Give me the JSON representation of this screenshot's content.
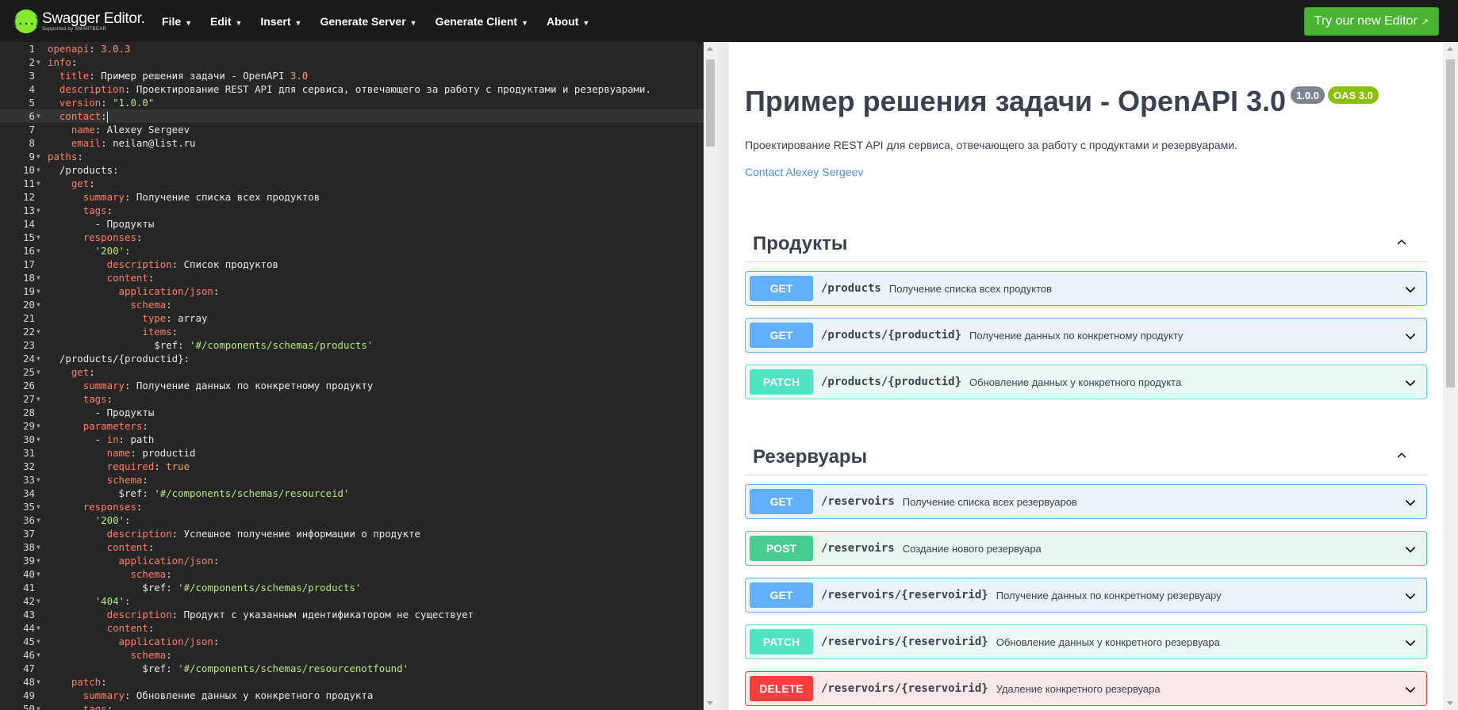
{
  "topbar": {
    "logo_title": "Swagger Editor.",
    "logo_sub": "Supported by SMARTBEAR",
    "logo_glyph": "{...}",
    "menu": [
      {
        "label": "File"
      },
      {
        "label": "Edit"
      },
      {
        "label": "Insert"
      },
      {
        "label": "Generate Server"
      },
      {
        "label": "Generate Client"
      },
      {
        "label": "About"
      }
    ],
    "caret": "▼",
    "try_button": "Try our new Editor",
    "try_button_icon": "↗"
  },
  "editor": {
    "lines": [
      {
        "n": "1",
        "f": false,
        "t": [
          [
            "k",
            "openapi"
          ],
          [
            "p",
            ": "
          ],
          [
            "n",
            "3.0.3"
          ]
        ]
      },
      {
        "n": "2",
        "f": true,
        "t": [
          [
            "k",
            "info"
          ],
          [
            "p",
            ":"
          ]
        ]
      },
      {
        "n": "3",
        "f": false,
        "t": [
          [
            "p",
            "  "
          ],
          [
            "k",
            "title"
          ],
          [
            "p",
            ": Пример решения задачи - OpenAPI "
          ],
          [
            "n",
            "3.0"
          ]
        ]
      },
      {
        "n": "4",
        "f": false,
        "t": [
          [
            "p",
            "  "
          ],
          [
            "k",
            "description"
          ],
          [
            "p",
            ": Проектирование REST API для сервиса, отвечающего за работу с продуктами и резервуарами."
          ]
        ]
      },
      {
        "n": "5",
        "f": false,
        "t": [
          [
            "p",
            "  "
          ],
          [
            "k",
            "version"
          ],
          [
            "p",
            ": "
          ],
          [
            "s",
            "\"1.0.0\""
          ]
        ]
      },
      {
        "n": "6",
        "f": true,
        "a": true,
        "t": [
          [
            "p",
            "  "
          ],
          [
            "k",
            "contact"
          ],
          [
            "p",
            ":"
          ]
        ]
      },
      {
        "n": "7",
        "f": false,
        "t": [
          [
            "p",
            "    "
          ],
          [
            "k",
            "name"
          ],
          [
            "p",
            ": Alexey Sergeev"
          ]
        ]
      },
      {
        "n": "8",
        "f": false,
        "t": [
          [
            "p",
            "    "
          ],
          [
            "k",
            "email"
          ],
          [
            "p",
            ": neilan@list.ru"
          ]
        ]
      },
      {
        "n": "9",
        "f": true,
        "t": [
          [
            "k",
            "paths"
          ],
          [
            "p",
            ":"
          ]
        ]
      },
      {
        "n": "10",
        "f": true,
        "t": [
          [
            "p",
            "  /products:"
          ]
        ]
      },
      {
        "n": "11",
        "f": true,
        "t": [
          [
            "p",
            "    "
          ],
          [
            "k",
            "get"
          ],
          [
            "p",
            ":"
          ]
        ]
      },
      {
        "n": "12",
        "f": false,
        "t": [
          [
            "p",
            "      "
          ],
          [
            "k",
            "summary"
          ],
          [
            "p",
            ": Получение списка всех продуктов"
          ]
        ]
      },
      {
        "n": "13",
        "f": true,
        "t": [
          [
            "p",
            "      "
          ],
          [
            "k",
            "tags"
          ],
          [
            "p",
            ":"
          ]
        ]
      },
      {
        "n": "14",
        "f": false,
        "t": [
          [
            "p",
            "        - Продукты"
          ]
        ]
      },
      {
        "n": "15",
        "f": true,
        "t": [
          [
            "p",
            "      "
          ],
          [
            "k",
            "responses"
          ],
          [
            "p",
            ":"
          ]
        ]
      },
      {
        "n": "16",
        "f": true,
        "t": [
          [
            "p",
            "        "
          ],
          [
            "s",
            "'200'"
          ],
          [
            "p",
            ":"
          ]
        ]
      },
      {
        "n": "17",
        "f": false,
        "t": [
          [
            "p",
            "          "
          ],
          [
            "k",
            "description"
          ],
          [
            "p",
            ": Список продуктов"
          ]
        ]
      },
      {
        "n": "18",
        "f": true,
        "t": [
          [
            "p",
            "          "
          ],
          [
            "k",
            "content"
          ],
          [
            "p",
            ":"
          ]
        ]
      },
      {
        "n": "19",
        "f": true,
        "t": [
          [
            "p",
            "            "
          ],
          [
            "k",
            "application/json"
          ],
          [
            "p",
            ":"
          ]
        ]
      },
      {
        "n": "20",
        "f": true,
        "t": [
          [
            "p",
            "              "
          ],
          [
            "k",
            "schema"
          ],
          [
            "p",
            ":"
          ]
        ]
      },
      {
        "n": "21",
        "f": false,
        "t": [
          [
            "p",
            "                "
          ],
          [
            "k",
            "type"
          ],
          [
            "p",
            ": array"
          ]
        ]
      },
      {
        "n": "22",
        "f": true,
        "t": [
          [
            "p",
            "                "
          ],
          [
            "k",
            "items"
          ],
          [
            "p",
            ":"
          ]
        ]
      },
      {
        "n": "23",
        "f": false,
        "t": [
          [
            "p",
            "                  $ref: "
          ],
          [
            "s",
            "'#/components/schemas/products'"
          ]
        ]
      },
      {
        "n": "24",
        "f": true,
        "t": [
          [
            "p",
            "  /products/{productid}:"
          ]
        ]
      },
      {
        "n": "25",
        "f": true,
        "t": [
          [
            "p",
            "    "
          ],
          [
            "k",
            "get"
          ],
          [
            "p",
            ":"
          ]
        ]
      },
      {
        "n": "26",
        "f": false,
        "t": [
          [
            "p",
            "      "
          ],
          [
            "k",
            "summary"
          ],
          [
            "p",
            ": Получение данных по конкретному продукту"
          ]
        ]
      },
      {
        "n": "27",
        "f": true,
        "t": [
          [
            "p",
            "      "
          ],
          [
            "k",
            "tags"
          ],
          [
            "p",
            ":"
          ]
        ]
      },
      {
        "n": "28",
        "f": false,
        "t": [
          [
            "p",
            "        - Продукты"
          ]
        ]
      },
      {
        "n": "29",
        "f": true,
        "t": [
          [
            "p",
            "      "
          ],
          [
            "k",
            "parameters"
          ],
          [
            "p",
            ":"
          ]
        ]
      },
      {
        "n": "30",
        "f": true,
        "t": [
          [
            "p",
            "        - "
          ],
          [
            "k",
            "in"
          ],
          [
            "p",
            ": path"
          ]
        ]
      },
      {
        "n": "31",
        "f": false,
        "t": [
          [
            "p",
            "          "
          ],
          [
            "k",
            "name"
          ],
          [
            "p",
            ": productid"
          ]
        ]
      },
      {
        "n": "32",
        "f": false,
        "t": [
          [
            "p",
            "          "
          ],
          [
            "k",
            "required"
          ],
          [
            "p",
            ": "
          ],
          [
            "n",
            "true"
          ]
        ]
      },
      {
        "n": "33",
        "f": true,
        "t": [
          [
            "p",
            "          "
          ],
          [
            "k",
            "schema"
          ],
          [
            "p",
            ":"
          ]
        ]
      },
      {
        "n": "34",
        "f": false,
        "t": [
          [
            "p",
            "            $ref: "
          ],
          [
            "s",
            "'#/components/schemas/resourceid'"
          ]
        ]
      },
      {
        "n": "35",
        "f": true,
        "t": [
          [
            "p",
            "      "
          ],
          [
            "k",
            "responses"
          ],
          [
            "p",
            ":"
          ]
        ]
      },
      {
        "n": "36",
        "f": true,
        "t": [
          [
            "p",
            "        "
          ],
          [
            "s",
            "'200'"
          ],
          [
            "p",
            ":"
          ]
        ]
      },
      {
        "n": "37",
        "f": false,
        "t": [
          [
            "p",
            "          "
          ],
          [
            "k",
            "description"
          ],
          [
            "p",
            ": Успешное получение информации о продукте"
          ]
        ]
      },
      {
        "n": "38",
        "f": true,
        "t": [
          [
            "p",
            "          "
          ],
          [
            "k",
            "content"
          ],
          [
            "p",
            ":"
          ]
        ]
      },
      {
        "n": "39",
        "f": true,
        "t": [
          [
            "p",
            "            "
          ],
          [
            "k",
            "application/json"
          ],
          [
            "p",
            ":"
          ]
        ]
      },
      {
        "n": "40",
        "f": true,
        "t": [
          [
            "p",
            "              "
          ],
          [
            "k",
            "schema"
          ],
          [
            "p",
            ":"
          ]
        ]
      },
      {
        "n": "41",
        "f": false,
        "t": [
          [
            "p",
            "                $ref: "
          ],
          [
            "s",
            "'#/components/schemas/products'"
          ]
        ]
      },
      {
        "n": "42",
        "f": true,
        "t": [
          [
            "p",
            "        "
          ],
          [
            "s",
            "'404'"
          ],
          [
            "p",
            ":"
          ]
        ]
      },
      {
        "n": "43",
        "f": false,
        "t": [
          [
            "p",
            "          "
          ],
          [
            "k",
            "description"
          ],
          [
            "p",
            ": Продукт с указанным идентификатором не существует"
          ]
        ]
      },
      {
        "n": "44",
        "f": true,
        "t": [
          [
            "p",
            "          "
          ],
          [
            "k",
            "content"
          ],
          [
            "p",
            ":"
          ]
        ]
      },
      {
        "n": "45",
        "f": true,
        "t": [
          [
            "p",
            "            "
          ],
          [
            "k",
            "application/json"
          ],
          [
            "p",
            ":"
          ]
        ]
      },
      {
        "n": "46",
        "f": true,
        "t": [
          [
            "p",
            "              "
          ],
          [
            "k",
            "schema"
          ],
          [
            "p",
            ":"
          ]
        ]
      },
      {
        "n": "47",
        "f": false,
        "t": [
          [
            "p",
            "                $ref: "
          ],
          [
            "s",
            "'#/components/schemas/resourcenotfound'"
          ]
        ]
      },
      {
        "n": "48",
        "f": true,
        "t": [
          [
            "p",
            "    "
          ],
          [
            "k",
            "patch"
          ],
          [
            "p",
            ":"
          ]
        ]
      },
      {
        "n": "49",
        "f": false,
        "t": [
          [
            "p",
            "      "
          ],
          [
            "k",
            "summary"
          ],
          [
            "p",
            ": Обновление данных у конкретного продукта"
          ]
        ]
      },
      {
        "n": "50",
        "f": true,
        "t": [
          [
            "p",
            "      "
          ],
          [
            "k",
            "tags"
          ],
          [
            "p",
            ":"
          ]
        ]
      }
    ]
  },
  "preview": {
    "title": "Пример решения задачи - OpenAPI 3.0",
    "version_badge": "1.0.0",
    "oas_badge": "OAS 3.0",
    "description": "Проектирование REST API для сервиса, отвечающего за работу с продуктами и резервуарами.",
    "contact": "Contact Alexey Sergeev",
    "tags": [
      {
        "name": "Продукты",
        "operations": [
          {
            "method": "GET",
            "path": "/products",
            "summary": "Получение списка всех продуктов"
          },
          {
            "method": "GET",
            "path": "/products/{productid}",
            "summary": "Получение данных по конкретному продукту"
          },
          {
            "method": "PATCH",
            "path": "/products/{productid}",
            "summary": "Обновление данных у конкретного продукта"
          }
        ]
      },
      {
        "name": "Резервуары",
        "operations": [
          {
            "method": "GET",
            "path": "/reservoirs",
            "summary": "Получение списка всех резервуаров"
          },
          {
            "method": "POST",
            "path": "/reservoirs",
            "summary": "Создание нового резервуара"
          },
          {
            "method": "GET",
            "path": "/reservoirs/{reservoirid}",
            "summary": "Получение данных по конкретному резервуару"
          },
          {
            "method": "PATCH",
            "path": "/reservoirs/{reservoirid}",
            "summary": "Обновление данных у конкретного резервуара"
          },
          {
            "method": "DELETE",
            "path": "/reservoirs/{reservoirid}",
            "summary": "Удаление конкретного резервуара"
          }
        ]
      }
    ]
  },
  "colors": {
    "get": "#61affe",
    "patch": "#50e3c2",
    "post": "#49cc90",
    "delete": "#f93e3e",
    "try_button": "#49b433",
    "logo": "#85ea2d"
  }
}
